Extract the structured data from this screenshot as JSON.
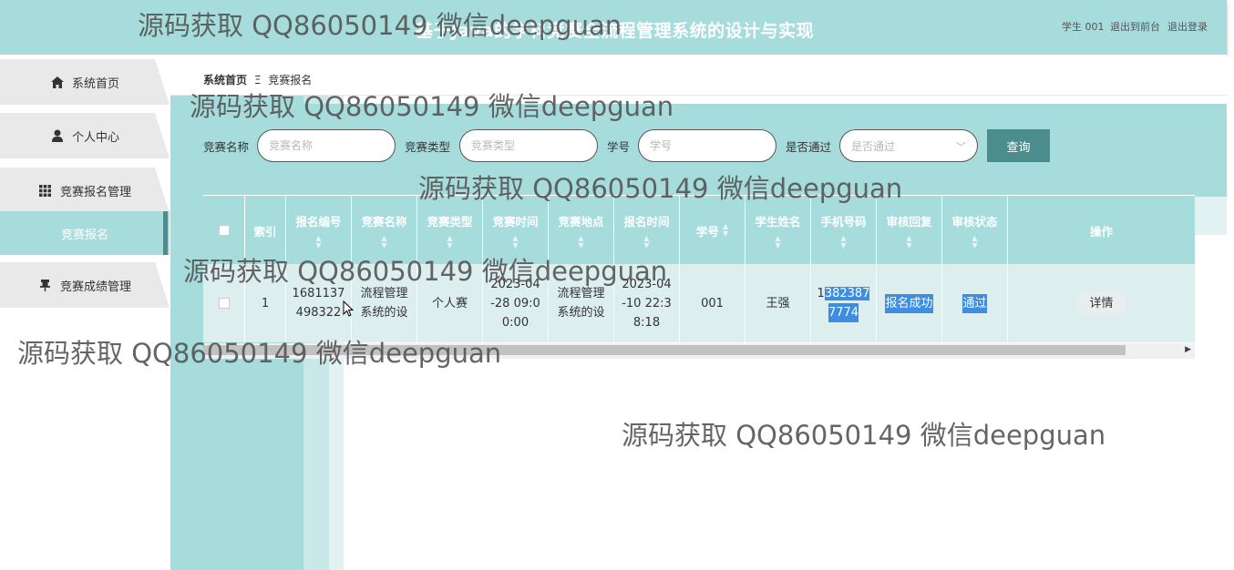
{
  "header": {
    "title": "基于Java的学科竞赛全流程管理系统的设计与实现",
    "user_label": "学生 001",
    "back_link": "退出到前台",
    "logout_link": "退出登录"
  },
  "sidebar": {
    "items": [
      {
        "label": "系统首页",
        "icon": "home-icon"
      },
      {
        "label": "个人中心",
        "icon": "user-icon"
      },
      {
        "label": "竞赛报名管理",
        "icon": "grid-icon"
      },
      {
        "label": "竞赛报名",
        "icon": ""
      },
      {
        "label": "竞赛成绩管理",
        "icon": "pin-icon"
      }
    ]
  },
  "breadcrumb": {
    "home": "系统首页",
    "separator": "Ξ",
    "current": "竞赛报名"
  },
  "search": {
    "name_label": "竞赛名称",
    "name_placeholder": "竞赛名称",
    "type_label": "竞赛类型",
    "type_placeholder": "竞赛类型",
    "student_label": "学号",
    "student_placeholder": "学号",
    "pass_label": "是否通过",
    "pass_placeholder": "是否通过",
    "query_button": "查询"
  },
  "table": {
    "headers": [
      "索引",
      "报名编号",
      "竞赛名称",
      "竞赛类型",
      "竞赛时间",
      "竞赛地点",
      "报名时间",
      "学号",
      "学生姓名",
      "手机号码",
      "审核回复",
      "审核状态",
      "操作"
    ],
    "row": {
      "index": "1",
      "reg_no_1": "1681137",
      "reg_no_2": "498322",
      "comp_name_1": "流程管理",
      "comp_name_2": "系统的设",
      "comp_type": "个人赛",
      "comp_time_1": "2023-04",
      "comp_time_2": "-28 09:0",
      "comp_time_3": "0:00",
      "place_1": "流程管理",
      "place_2": "系统的设",
      "reg_time_1": "2023-04",
      "reg_time_2": "-10 22:3",
      "reg_time_3": "8:18",
      "student_no": "001",
      "student_name": "王强",
      "phone_1a": "1",
      "phone_1b": "382387",
      "phone_2": "7774",
      "reply": "报名成功",
      "status": "通过",
      "detail_button": "详情"
    }
  },
  "watermark": "源码获取 QQ86050149 微信deepguan",
  "colors": {
    "accent": "#a6dcdc",
    "dark_accent": "#4b8d8d",
    "row_bg": "#dceeee",
    "highlight": "#3d8de2"
  }
}
